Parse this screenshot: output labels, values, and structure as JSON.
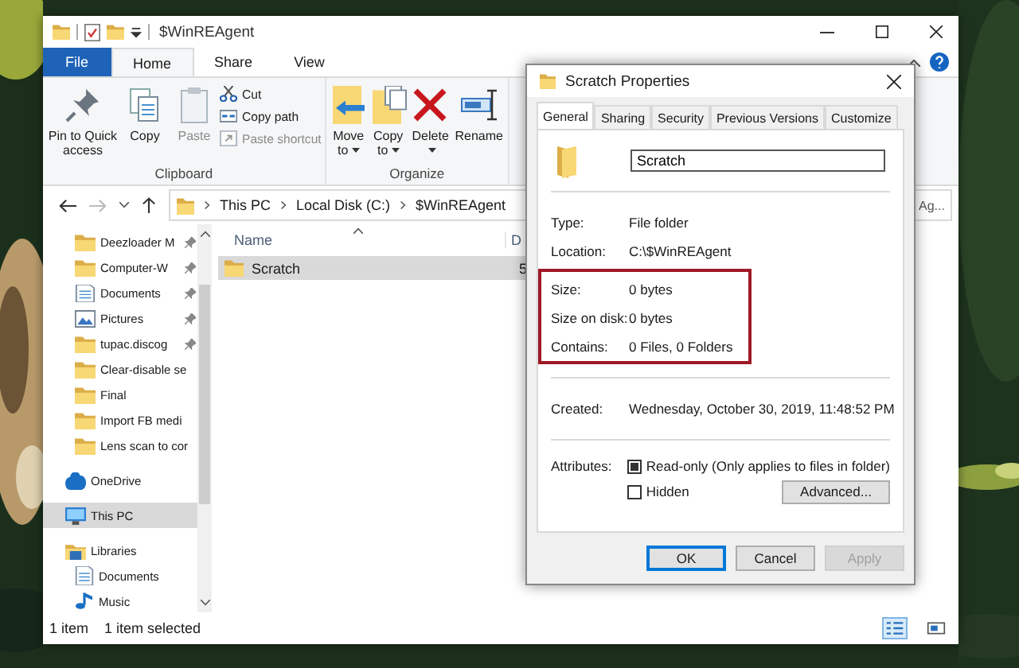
{
  "explorer": {
    "title": "$WinREAgent",
    "ribbon_tabs": [
      {
        "label": "File",
        "kind": "file",
        "selected": false
      },
      {
        "label": "Home",
        "kind": "tab",
        "selected": true
      },
      {
        "label": "Share",
        "kind": "tab",
        "selected": false
      },
      {
        "label": "View",
        "kind": "tab",
        "selected": false
      }
    ],
    "ribbon_groups": [
      {
        "label": "Clipboard",
        "buttons": [
          {
            "label": "Pin to Quick access",
            "kind": "pin",
            "disabled": false,
            "dropdown": false
          },
          {
            "label": "Copy",
            "kind": "copy",
            "disabled": false,
            "dropdown": false
          },
          {
            "label": "Paste",
            "kind": "paste",
            "disabled": true,
            "dropdown": false
          },
          {
            "label": "Cut",
            "kind": "cut",
            "disabled": false,
            "dropdown": false
          },
          {
            "label": "Copy path",
            "kind": "copypath",
            "disabled": false,
            "dropdown": false
          },
          {
            "label": "Paste shortcut",
            "kind": "shortcut",
            "disabled": true,
            "dropdown": false
          }
        ]
      },
      {
        "label": "Organize",
        "buttons": [
          {
            "label": "Move to",
            "kind": "moveto",
            "disabled": false,
            "dropdown": true
          },
          {
            "label": "Copy to",
            "kind": "copyto",
            "disabled": false,
            "dropdown": true
          },
          {
            "label": "Delete",
            "kind": "delete",
            "disabled": false,
            "dropdown": true
          },
          {
            "label": "Rename",
            "kind": "rename",
            "disabled": false,
            "dropdown": false
          }
        ]
      }
    ],
    "crumbs": [
      "This PC",
      "Local Disk (C:)",
      "$WinREAgent"
    ],
    "search": {
      "placeholder": "Ag..."
    },
    "nav": {
      "sections": [
        {
          "kind": "quick",
          "items": [
            {
              "label": "Deezloader M",
              "kind": "folder",
              "pinned": true,
              "selected": false
            },
            {
              "label": "Computer-W",
              "kind": "folder",
              "pinned": true,
              "selected": false
            },
            {
              "label": "Documents",
              "kind": "documents",
              "pinned": true,
              "selected": false
            },
            {
              "label": "Pictures",
              "kind": "pictures",
              "pinned": true,
              "selected": false
            },
            {
              "label": "tupac.discog",
              "kind": "folder",
              "pinned": true,
              "selected": false
            },
            {
              "label": "Clear-disable se",
              "kind": "folder",
              "pinned": false,
              "selected": false
            },
            {
              "label": "Final",
              "kind": "folder",
              "pinned": false,
              "selected": false
            },
            {
              "label": "Import FB medi",
              "kind": "folder",
              "pinned": false,
              "selected": false
            },
            {
              "label": "Lens scan to cor",
              "kind": "folder",
              "pinned": false,
              "selected": false
            }
          ]
        },
        {
          "kind": "top",
          "items": [
            {
              "label": "OneDrive",
              "kind": "cloud",
              "selected": false
            }
          ]
        },
        {
          "kind": "top",
          "items": [
            {
              "label": "This PC",
              "kind": "pc",
              "selected": true
            }
          ]
        },
        {
          "kind": "top",
          "items": [
            {
              "label": "Libraries",
              "kind": "libraries",
              "selected": false,
              "children": [
                {
                  "label": "Documents",
                  "kind": "documents",
                  "selected": false
                },
                {
                  "label": "Music",
                  "kind": "music",
                  "selected": false
                }
              ]
            }
          ]
        }
      ]
    },
    "columns": [
      "Name",
      "D"
    ],
    "rows": [
      {
        "cells": [
          "Scratch",
          "5"
        ],
        "selected": true
      }
    ],
    "status": [
      "1 item",
      "1 item selected"
    ],
    "views": [
      {
        "kind": "details",
        "selected": true
      },
      {
        "kind": "tiles",
        "selected": false
      }
    ]
  },
  "dialog": {
    "title": "Scratch Properties",
    "tabs": [
      {
        "label": "General",
        "selected": true
      },
      {
        "label": "Sharing",
        "selected": false
      },
      {
        "label": "Security",
        "selected": false
      },
      {
        "label": "Previous Versions",
        "selected": false
      },
      {
        "label": "Customize",
        "selected": false
      }
    ],
    "name": "Scratch",
    "sections": [
      {
        "highlighted": false,
        "rows": [
          {
            "label": "Type:",
            "value": "File folder"
          },
          {
            "label": "Location:",
            "value": "C:\\$WinREAgent"
          }
        ]
      },
      {
        "highlighted": true,
        "rows": [
          {
            "label": "Size:",
            "value": "0 bytes"
          },
          {
            "label": "Size on disk:",
            "value": "0 bytes"
          },
          {
            "label": "Contains:",
            "value": "0 Files, 0 Folders"
          }
        ]
      },
      {
        "highlighted": false,
        "rows": [
          {
            "label": "Created:",
            "value": "Wednesday, October 30, 2019, 11:48:52 PM"
          }
        ]
      }
    ],
    "attributes_label": "Attributes:",
    "attributes": [
      {
        "label": "Read-only (Only applies to files in folder)",
        "checked": false,
        "indeterminate": true
      },
      {
        "label": "Hidden",
        "checked": false,
        "indeterminate": false
      }
    ],
    "advanced": "Advanced...",
    "buttons": [
      {
        "label": "OK",
        "kind": "default",
        "disabled": false
      },
      {
        "label": "Cancel",
        "kind": "normal",
        "disabled": false
      },
      {
        "label": "Apply",
        "kind": "normal",
        "disabled": true
      }
    ]
  }
}
